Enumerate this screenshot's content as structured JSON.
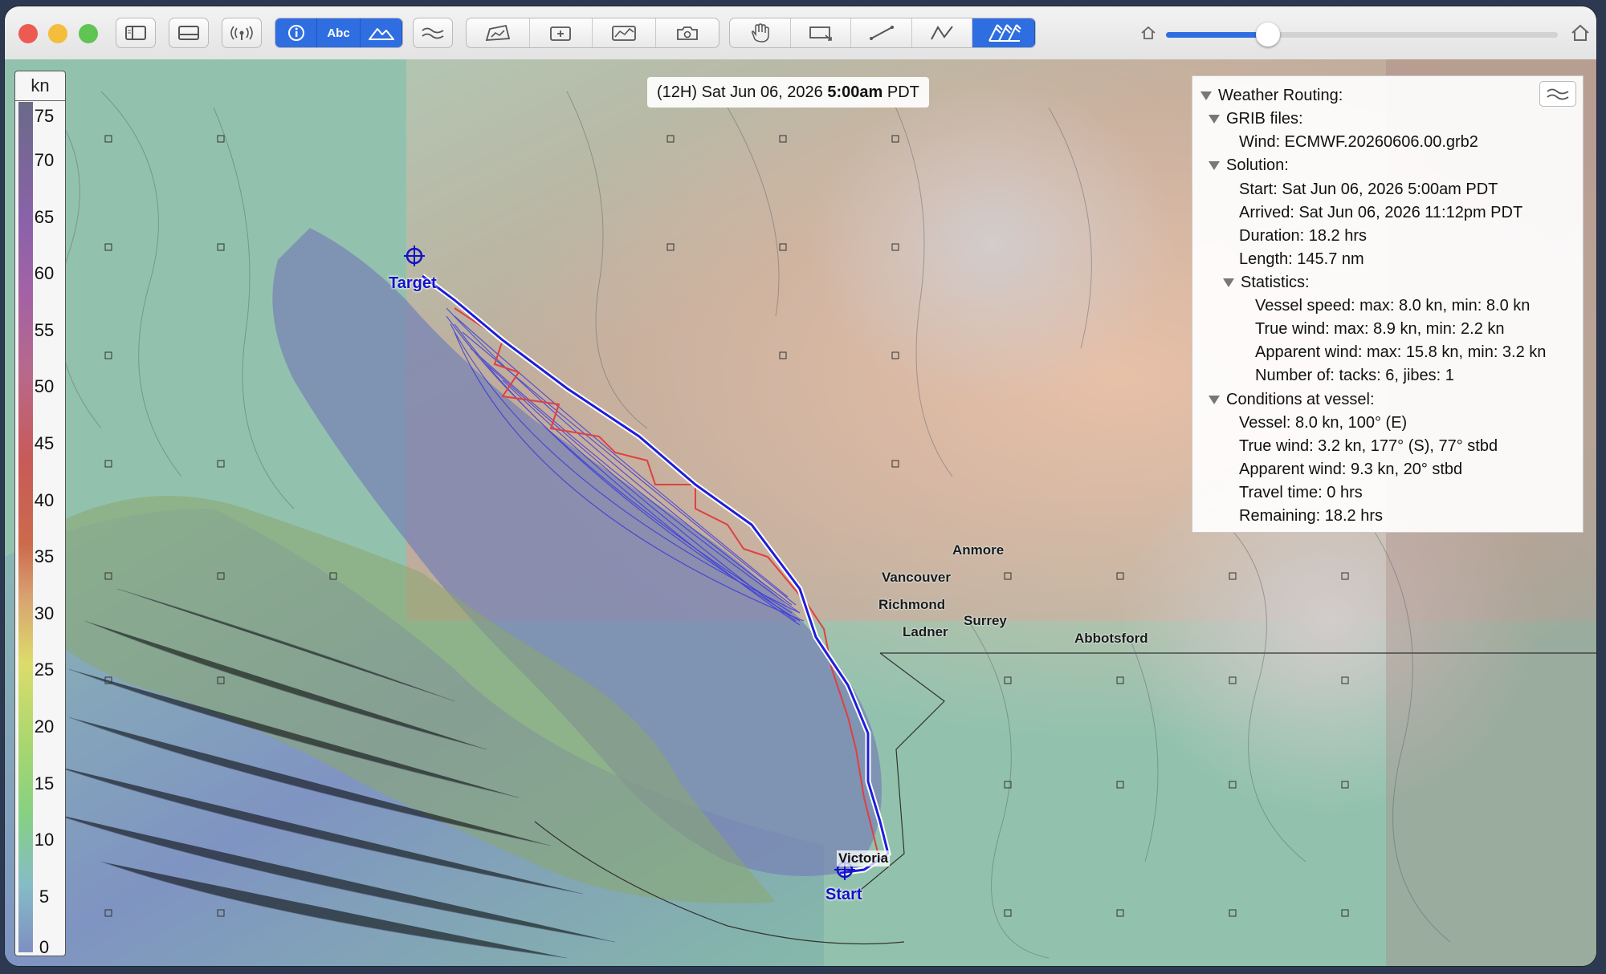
{
  "toolbar": {
    "traffic_lights": {
      "close_color": "#ec5a52",
      "minimize_color": "#f4bd3b",
      "zoom_color": "#5fc453"
    },
    "view_buttons": [
      {
        "name": "sidebar-toggle-icon"
      },
      {
        "name": "bottom-panel-toggle-icon"
      },
      {
        "name": "broadcast-icon"
      }
    ],
    "overlay_group": {
      "info_icon": "info-circle-icon",
      "labels_text": "Abc",
      "terrain_icon": "mountain-icon"
    },
    "layer_button_icon": "wind-lines-icon",
    "tools_group": [
      "chart-icon",
      "add-waypoint-icon",
      "graph-icon",
      "camera-icon"
    ],
    "interaction_group": [
      "hand-icon",
      "measure-box-icon",
      "line-icon",
      "polyline-icon",
      "wind-barbs-icon"
    ],
    "zoom_slider": {
      "value": 0.18
    },
    "accent_color": "#2f6ee0"
  },
  "legend": {
    "unit": "kn",
    "ticks": [
      "75",
      "70",
      "65",
      "60",
      "55",
      "50",
      "45",
      "40",
      "35",
      "30",
      "25",
      "20",
      "15",
      "10",
      "5",
      "0"
    ]
  },
  "time": {
    "prefix": "(12H) Sat Jun 06, 2026",
    "time_bold": "5:00am",
    "zone": "PDT"
  },
  "panel": {
    "title": "Weather Routing:",
    "grib_header": "GRIB files:",
    "grib_wind": "Wind: ECMWF.20260606.00.grb2",
    "solution_header": "Solution:",
    "start": "Start: Sat Jun 06, 2026 5:00am PDT",
    "arrived": "Arrived: Sat Jun 06, 2026 11:12pm PDT",
    "duration": "Duration: 18.2 hrs",
    "length": "Length: 145.7 nm",
    "statistics_header": "Statistics:",
    "vessel_speed": "Vessel speed: max: 8.0 kn, min: 8.0 kn",
    "true_wind": "True wind: max: 8.9 kn, min: 2.2 kn",
    "apparent_wind": "Apparent wind: max: 15.8 kn, min: 3.2 kn",
    "tacks": "Number of: tacks: 6, jibes: 1",
    "conditions_header": "Conditions at vessel:",
    "vessel": "Vessel: 8.0 kn, 100° (E)",
    "cond_true_wind": "True wind: 3.2 kn, 177° (S), 77° stbd",
    "cond_apparent_wind": "Apparent wind: 9.3 kn, 20° stbd",
    "travel_time": "Travel time: 0 hrs",
    "remaining": "Remaining: 18.2 hrs"
  },
  "map": {
    "places": {
      "anmore": "Anmore",
      "vancouver": "Vancouver",
      "richmond": "Richmond",
      "ladner": "Ladner",
      "surrey": "Surrey",
      "abbotsford": "Abbotsford",
      "victoria": "Victoria"
    },
    "route_labels": {
      "target": "Target",
      "start": "Start"
    },
    "route_color": "#1e1ed8",
    "alt_route_color": "#e04040"
  }
}
